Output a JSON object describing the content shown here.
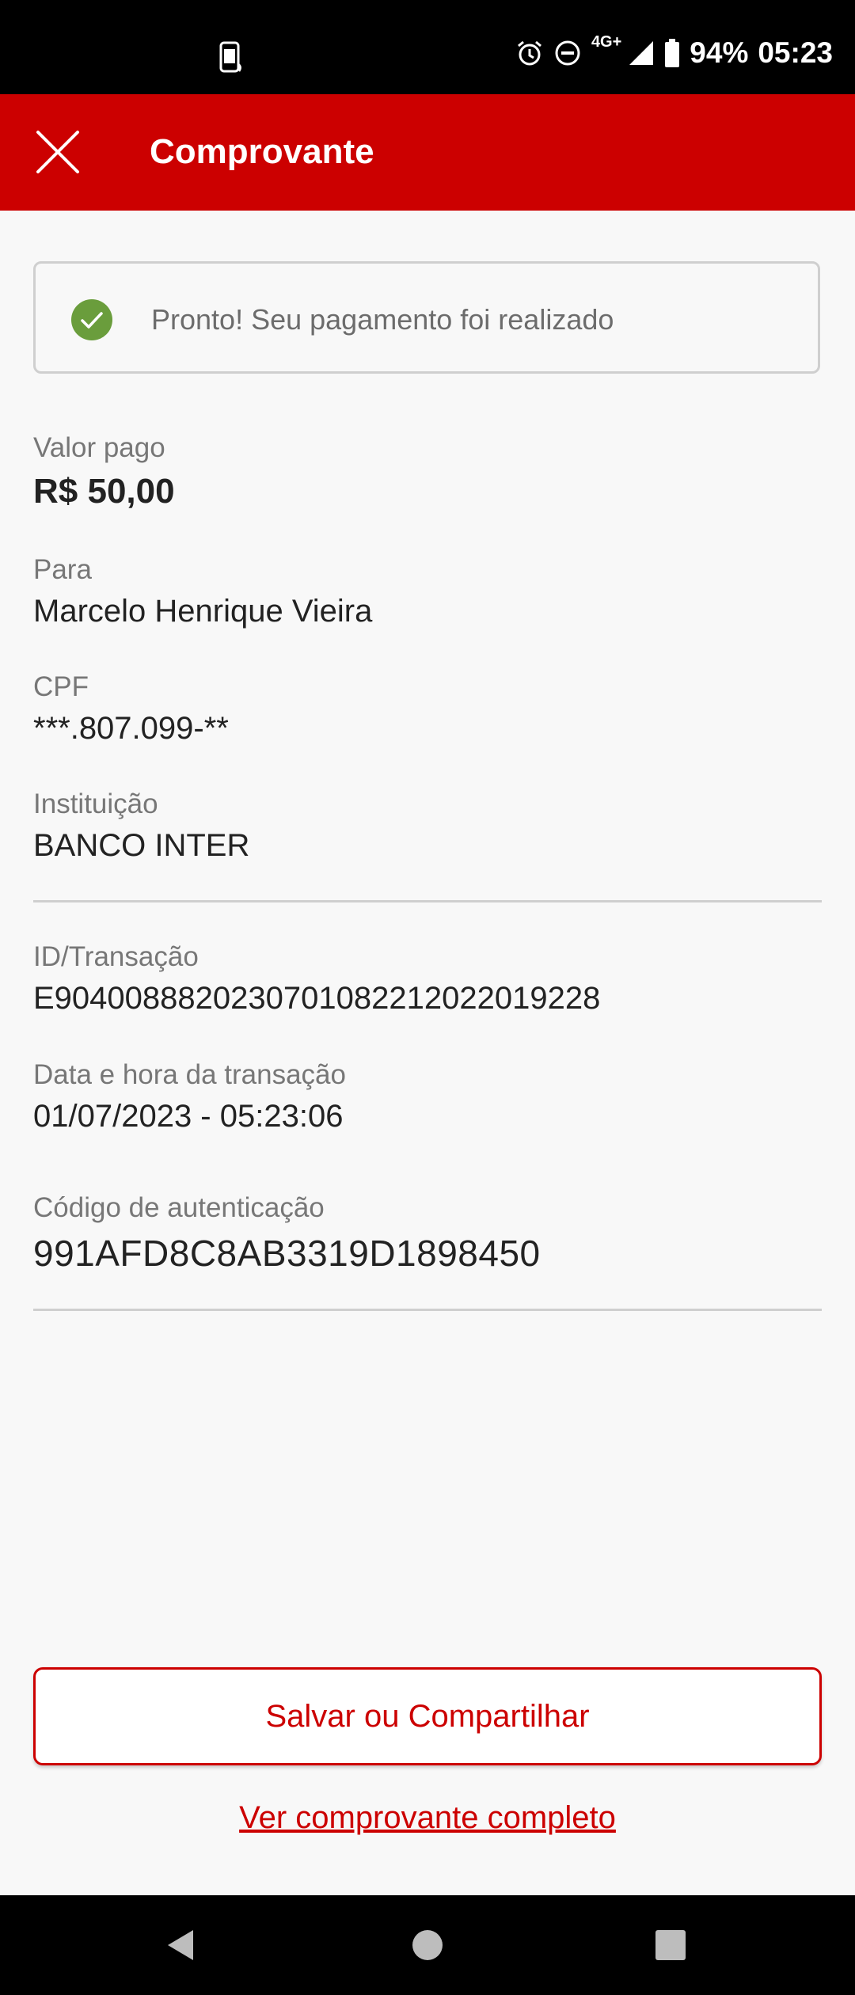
{
  "status_bar": {
    "network": "4G+",
    "battery": "94%",
    "time": "05:23",
    "icons": [
      "screen-rotate-icon",
      "alarm-icon",
      "do-not-disturb-icon",
      "signal-icon",
      "battery-icon"
    ]
  },
  "app_bar": {
    "title": "Comprovante",
    "close_icon": "close-icon"
  },
  "banner": {
    "text": "Pronto! Seu pagamento foi realizado",
    "icon": "check-circle-icon",
    "icon_color": "#6a9d3c"
  },
  "details": {
    "valor_label": "Valor pago",
    "valor_value": "R$ 50,00",
    "para_label": "Para",
    "para_value": "Marcelo Henrique Vieira",
    "cpf_label": "CPF",
    "cpf_value": "***.807.099-**",
    "instituicao_label": "Instituição",
    "instituicao_value": "BANCO INTER",
    "id_label": "ID/Transação",
    "id_value": "E90400888202307010822120220192​28",
    "data_label": "Data e hora da transação",
    "data_value": "01/07/2023 - 05:23:06",
    "codigo_label": "Código de autenticação",
    "codigo_value": "991AFD8C8AB3319D1898450"
  },
  "actions": {
    "save_share_label": "Salvar ou Compartilhar",
    "full_receipt_label": "Ver comprovante completo"
  },
  "colors": {
    "brand": "#cc0000",
    "success": "#6a9d3c"
  },
  "nav_bar": {
    "icons": [
      "back-icon",
      "home-icon",
      "recents-icon"
    ]
  }
}
